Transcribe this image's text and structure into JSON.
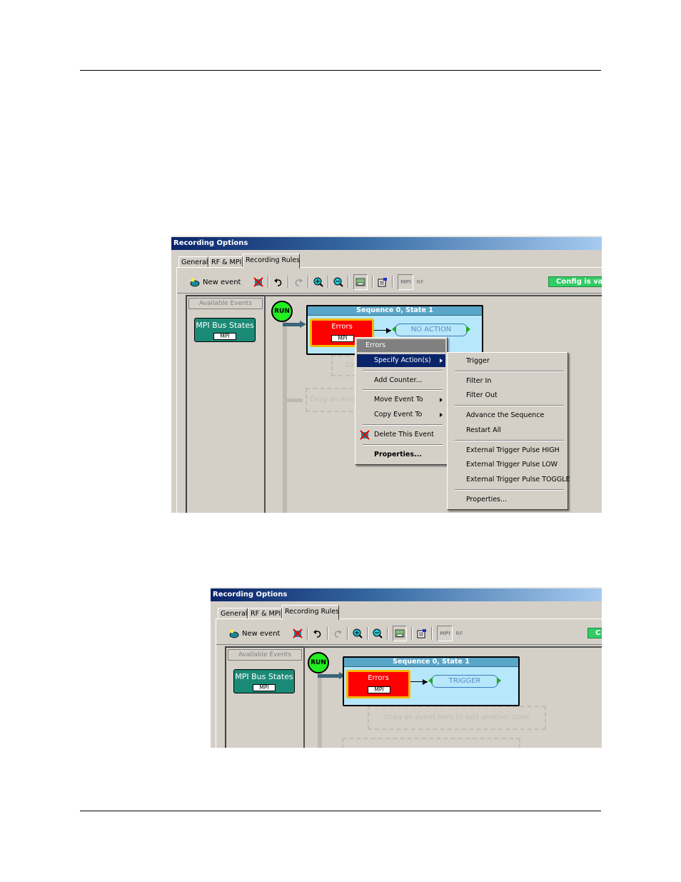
{
  "screenshot1": {
    "window_title": "Recording Options",
    "tabs": [
      {
        "label": "General",
        "active": false
      },
      {
        "label": "RF & MPI",
        "active": false
      },
      {
        "label": "Recording Rules",
        "active": true
      }
    ],
    "toolbar": {
      "new_event_label": "New event",
      "mpi_toggle_label": "MPI",
      "rf_toggle_label": "RF"
    },
    "config_status": "Config is valid",
    "available_events_label": "Available Events",
    "event_chip": {
      "label": "MPI Bus States",
      "tag": "MPI"
    },
    "run_label": "RUN",
    "state": {
      "title": "Sequence 0, State 1",
      "event_label": "Errors",
      "event_tag": "MPI",
      "action_label": "NO ACTION"
    },
    "drop_zones": [
      "Drag an event here to add another state",
      "Drag an event here"
    ],
    "context_menu": {
      "header": "Errors",
      "items": [
        {
          "label": "Specify Action(s)",
          "submenu": true,
          "highlighted": true
        },
        {
          "label": "Add Counter..."
        },
        {
          "label": "Move Event To",
          "submenu": true
        },
        {
          "label": "Copy Event To",
          "submenu": true
        },
        {
          "label": "Delete This Event",
          "icon": "delete-icon"
        },
        {
          "label": "Properties...",
          "bold": true
        }
      ]
    },
    "submenu": {
      "items": [
        "Trigger",
        "Filter In",
        "Filter Out",
        "Advance the Sequence",
        "Restart All",
        "External Trigger Pulse HIGH",
        "External Trigger Pulse LOW",
        "External Trigger Pulse TOGGLE",
        "Properties..."
      ]
    }
  },
  "screenshot2": {
    "window_title": "Recording Options",
    "tabs": [
      {
        "label": "General",
        "active": false
      },
      {
        "label": "RF & MPI",
        "active": false
      },
      {
        "label": "Recording Rules",
        "active": true
      }
    ],
    "toolbar": {
      "new_event_label": "New event",
      "mpi_toggle_label": "MPI",
      "rf_toggle_label": "RF"
    },
    "config_status": "C",
    "available_events_label": "Available Events",
    "event_chip": {
      "label": "MPI Bus States",
      "tag": "MPI"
    },
    "run_label": "RUN",
    "state": {
      "title": "Sequence 0, State 1",
      "event_label": "Errors",
      "event_tag": "MPI",
      "action_label": "TRIGGER"
    },
    "drop_zone": "Drag an event here to add another state"
  }
}
